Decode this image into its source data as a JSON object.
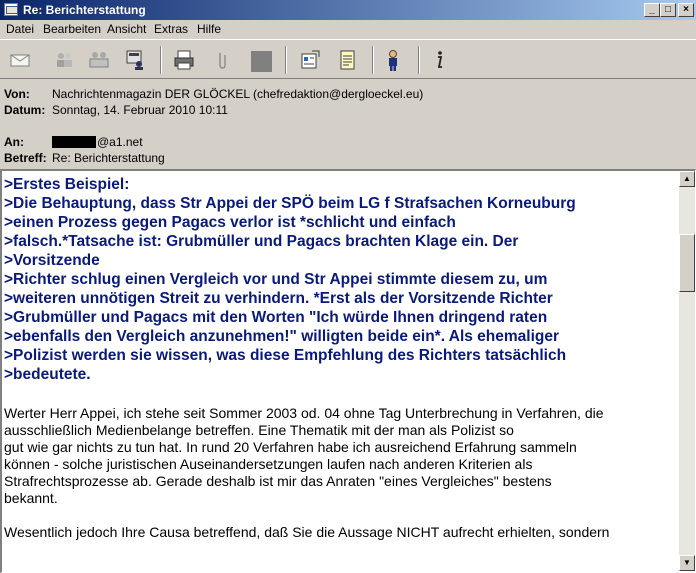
{
  "window": {
    "title": "Re: Berichterstattung",
    "buttons": {
      "minimize": "_",
      "maximize": "□",
      "close": "×"
    }
  },
  "menu": [
    "Datei",
    "Bearbeiten",
    "Ansicht",
    "Extras",
    "Hilfe"
  ],
  "toolbar": {
    "icons": [
      "reply-icon",
      "reply-all-icon",
      "forward-icon",
      "address-book-icon",
      "print-icon",
      "attach-icon",
      "stop-icon",
      "properties-icon",
      "note-icon",
      "contact-icon",
      "help-icon"
    ]
  },
  "headers": {
    "from_label": "Von:",
    "from_value": "Nachrichtenmagazin DER GLÖCKEL (chefredaktion@dergloeckel.eu)",
    "date_label": "Datum:",
    "date_value": "Sonntag, 14. Februar 2010 10:11",
    "to_label": "An:",
    "to_value": "@a1.net",
    "subject_label": "Betreff:",
    "subject_value": "Re: Berichterstattung"
  },
  "body": {
    "quote_lines": [
      ">Erstes Beispiel:",
      ">Die Behauptung, dass Str Appei der SPÖ beim LG f Strafsachen Korneuburg",
      ">einen Prozess gegen Pagacs verlor ist *schlicht und einfach",
      ">falsch.*Tatsache ist: Grubmüller und Pagacs brachten Klage ein. Der",
      ">Vorsitzende",
      ">Richter schlug einen Vergleich vor und Str Appei stimmte diesem zu, um",
      ">weiteren unnötigen Streit zu verhindern. *Erst als der Vorsitzende Richter",
      ">Grubmüller und Pagacs mit den Worten \"Ich würde Ihnen dringend raten",
      ">ebenfalls den Vergleich anzunehmen!\" willigten beide ein*. Als ehemaliger",
      ">Polizist werden sie wissen, was diese Empfehlung des Richters tatsächlich",
      ">bedeutete."
    ],
    "paragraph1_lines": [
      "Werter Herr Appei, ich stehe seit Sommer 2003 od. 04 ohne Tag Unterbrechung in Verfahren, die",
      "ausschließlich Medienbelange betreffen. Eine Thematik mit der man als Polizist so",
      "gut wie gar nichts zu tun hat. In rund 20 Verfahren habe ich ausreichend Erfahrung sammeln",
      "können - solche juristischen Auseinandersetzungen laufen nach anderen Kriterien als",
      "Strafrechtsprozesse ab. Gerade deshalb ist mir das Anraten \"eines Vergleiches\" bestens",
      "bekannt."
    ],
    "paragraph2_lines": [
      "Wesentlich jedoch Ihre Causa betreffend, daß Sie die Aussage NICHT aufrecht erhielten, sondern"
    ]
  },
  "scrollbar": {
    "up": "▲",
    "down": "▼",
    "position": 0.15
  }
}
